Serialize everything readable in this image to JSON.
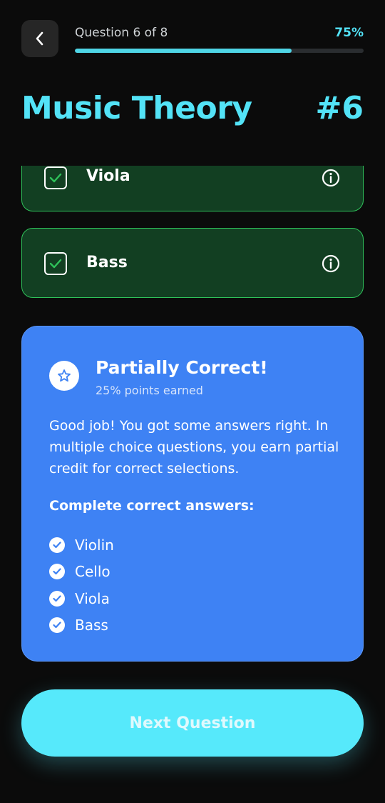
{
  "header": {
    "progress_text": "Question 6 of 8",
    "progress_percent_label": "75%",
    "progress_value": 0.75,
    "title": "Music Theory",
    "question_number": "#6"
  },
  "options": [
    {
      "label": "Viola",
      "checked": true
    },
    {
      "label": "Bass",
      "checked": true
    }
  ],
  "feedback": {
    "icon": "star-icon",
    "title": "Partially Correct!",
    "subtitle": "25% points earned",
    "body": "Good job! You got some answers right. In multiple choice questions, you earn partial credit for correct selections.",
    "answers_title": "Complete correct answers:",
    "answers": [
      "Violin",
      "Cello",
      "Viola",
      "Bass"
    ]
  },
  "actions": {
    "next_label": "Next Question"
  },
  "colors": {
    "accent": "#53e3f7",
    "correct_bg": "#123f22",
    "correct_border": "#2fc25a",
    "feedback_bg": "#3e82f4"
  }
}
